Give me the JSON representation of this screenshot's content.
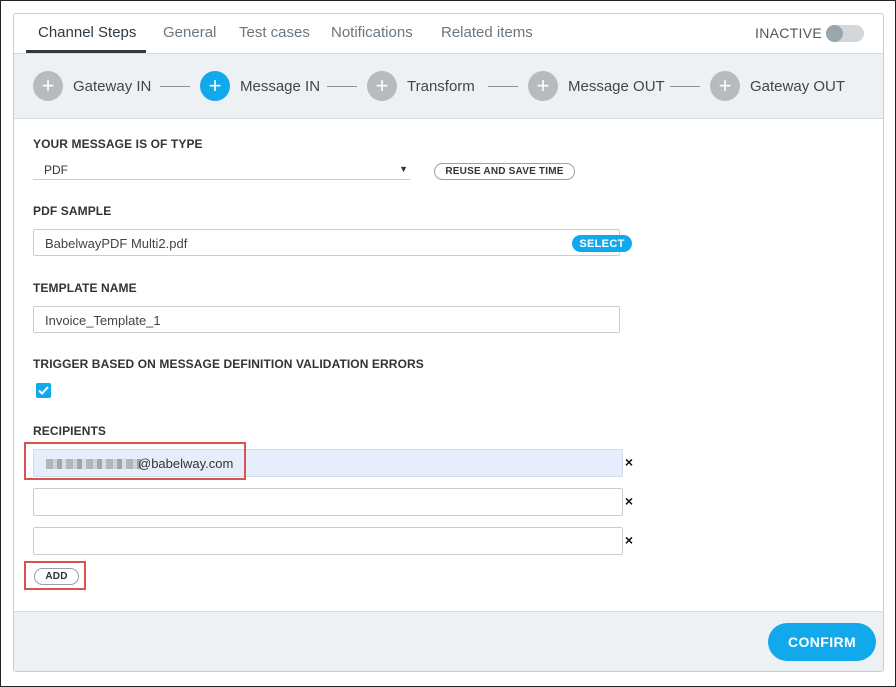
{
  "tabs": [
    {
      "label": "Channel Steps",
      "active": true
    },
    {
      "label": "General"
    },
    {
      "label": "Test cases"
    },
    {
      "label": "Notifications"
    },
    {
      "label": "Related items"
    }
  ],
  "status": {
    "label": "INACTIVE",
    "enabled": false
  },
  "steps": [
    {
      "label": "Gateway IN",
      "icon": "plus-icon"
    },
    {
      "label": "Message IN",
      "icon": "plus-icon",
      "active": true
    },
    {
      "label": "Transform",
      "icon": "plus-icon"
    },
    {
      "label": "Message OUT",
      "icon": "plus-icon"
    },
    {
      "label": "Gateway OUT",
      "icon": "plus-icon"
    }
  ],
  "form": {
    "message_type_label": "YOUR MESSAGE IS OF TYPE",
    "message_type_value": "PDF",
    "reuse_button": "REUSE AND SAVE TIME",
    "pdf_sample_label": "PDF SAMPLE",
    "pdf_sample_value": "BabelwayPDF Multi2.pdf",
    "select_button": "SELECT",
    "template_name_label": "TEMPLATE NAME",
    "template_name_value": "Invoice_Template_1",
    "trigger_label": "TRIGGER BASED ON MESSAGE DEFINITION VALIDATION ERRORS",
    "trigger_checked": true,
    "recipients_label": "RECIPIENTS",
    "recipients": [
      {
        "value": "@babelway.com",
        "redacted_prefix": true
      },
      {
        "value": ""
      },
      {
        "value": ""
      }
    ],
    "remove_symbol": "×",
    "add_button": "ADD"
  },
  "footer": {
    "confirm_button": "CONFIRM"
  },
  "colors": {
    "accent": "#12a8ec",
    "highlight": "#d9534f",
    "muted_step": "#b5bbbf"
  }
}
